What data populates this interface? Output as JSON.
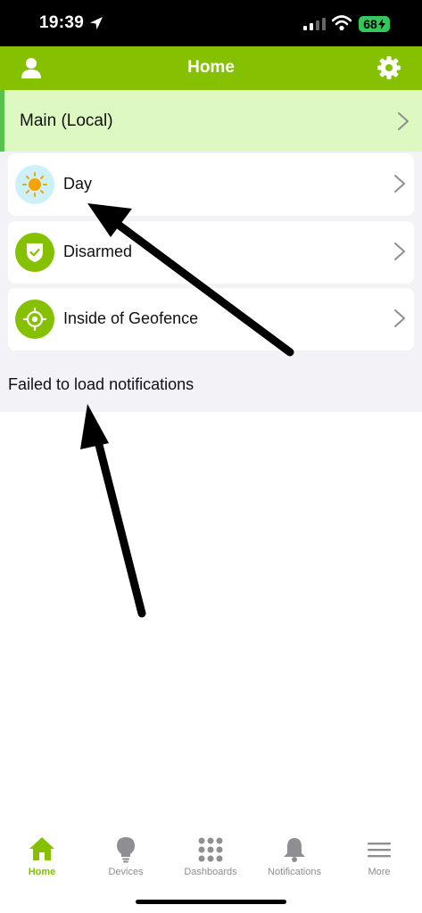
{
  "status_bar": {
    "time": "19:39",
    "battery": "68"
  },
  "header": {
    "title": "Home"
  },
  "location": {
    "label": "Main (Local)"
  },
  "cards": [
    {
      "label": "Day",
      "icon": "sun-icon"
    },
    {
      "label": "Disarmed",
      "icon": "shield-check-icon"
    },
    {
      "label": "Inside of Geofence",
      "icon": "geofence-target-icon"
    }
  ],
  "notifications": {
    "error_text": "Failed to load notifications"
  },
  "tabs": [
    {
      "label": "Home",
      "icon": "home-icon",
      "active": true
    },
    {
      "label": "Devices",
      "icon": "lightbulb-icon",
      "active": false
    },
    {
      "label": "Dashboards",
      "icon": "grid-dots-icon",
      "active": false
    },
    {
      "label": "Notifications",
      "icon": "bell-icon",
      "active": false
    },
    {
      "label": "More",
      "icon": "menu-icon",
      "active": false
    }
  ],
  "colors": {
    "accent": "#85c100",
    "location_bg": "#ddf8c0",
    "location_border": "#55c24a",
    "page_bg": "#f2f2f7",
    "sun_bg": "#cdf1f8",
    "sun": "#f5a300",
    "battery": "#34c759"
  }
}
